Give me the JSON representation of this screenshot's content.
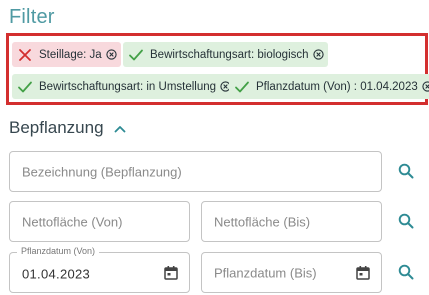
{
  "header": {
    "title": "Filter"
  },
  "filter_chips": [
    {
      "type": "exclude",
      "label": "Steillage: Ja"
    },
    {
      "type": "include",
      "label": "Bewirtschaftungsart: biologisch"
    },
    {
      "type": "include",
      "label": "Bewirtschaftungsart: in Umstellung"
    },
    {
      "type": "include",
      "label": "Pflanzdatum (Von) : 01.04.2023"
    }
  ],
  "section": {
    "title": "Bepflanzung",
    "expanded": true,
    "toggle_icon": "chevron-up-icon"
  },
  "fields": {
    "bezeichnung": {
      "placeholder": "Bezeichnung (Bepflanzung)",
      "value": ""
    },
    "nettoflaeche_von": {
      "placeholder": "Nettofläche (Von)",
      "value": ""
    },
    "nettoflaeche_bis": {
      "placeholder": "Nettofläche (Bis)",
      "value": ""
    },
    "pflanzdatum_von": {
      "label": "Pflanzdatum (Von)",
      "value": "01.04.2023"
    },
    "pflanzdatum_bis": {
      "placeholder": "Pflanzdatum (Bis)",
      "value": ""
    }
  },
  "icons": {
    "exclude": "close-icon",
    "include": "check-icon",
    "remove": "cancel-circle-icon",
    "search": "search-icon",
    "calendar": "calendar-icon"
  },
  "colors": {
    "title": "#4f9aa3",
    "accent": "#2e8b94",
    "exclude_chip_bg": "#f8d9dd",
    "include_chip_bg": "#def0de",
    "exclude_mark": "#d32f2f",
    "include_mark": "#43a047",
    "highlight_border": "#d32f2f"
  }
}
